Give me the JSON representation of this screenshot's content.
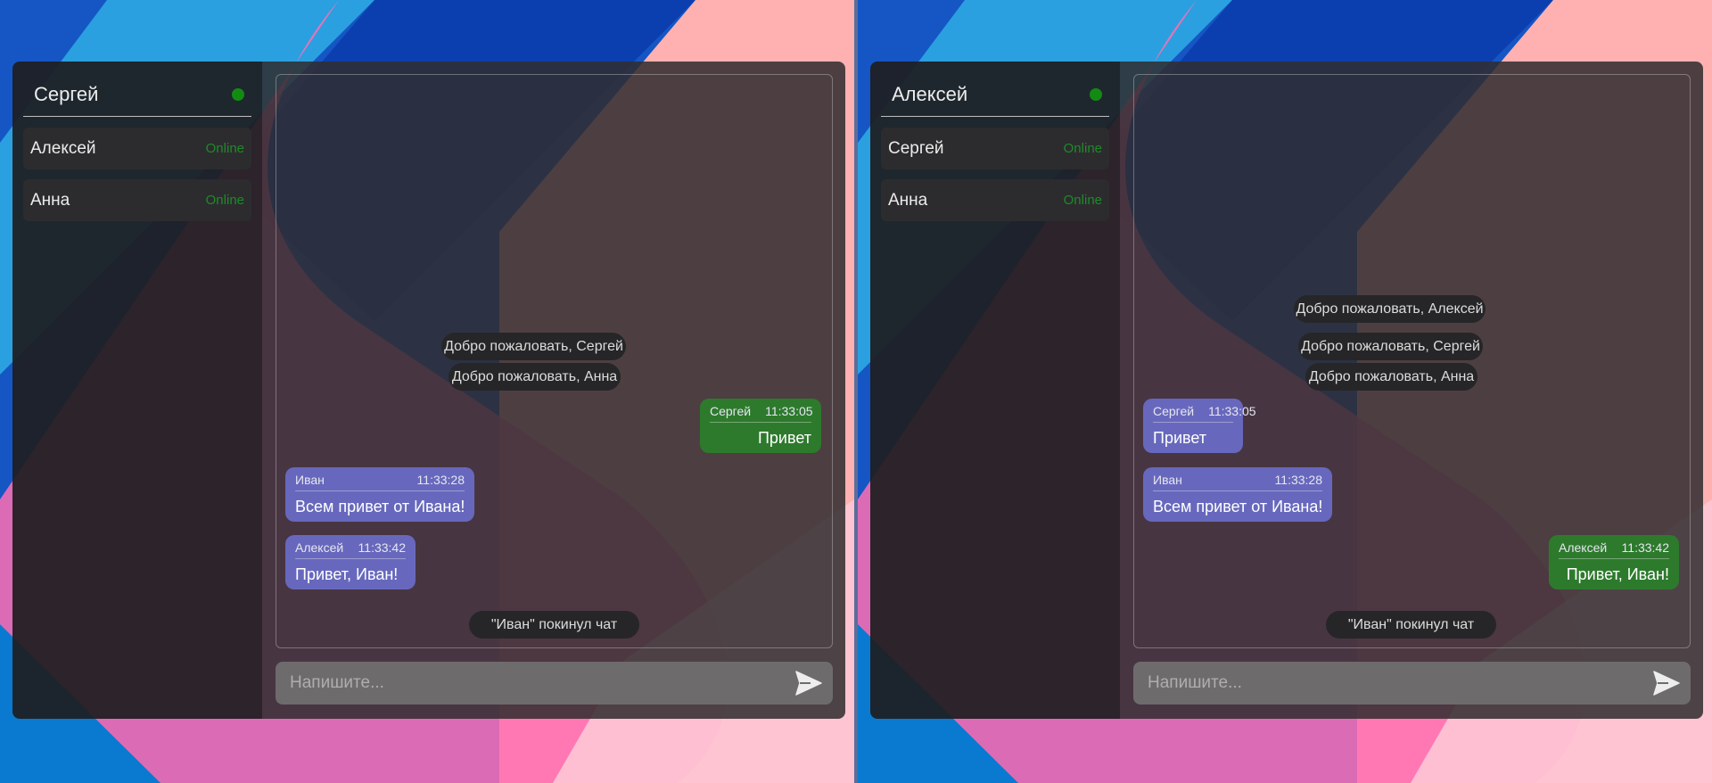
{
  "windows": [
    {
      "current_user": "Сергей",
      "users": [
        {
          "name": "Алексей",
          "status": "Online"
        },
        {
          "name": "Анна",
          "status": "Online"
        }
      ],
      "system_messages": [
        "Добро пожаловать, Сергей",
        "Добро пожаловать, Анна",
        "\"Иван\" покинул чат"
      ],
      "messages": [
        {
          "author": "Сергей",
          "time": "11:33:05",
          "text": "Привет",
          "own": true
        },
        {
          "author": "Иван",
          "time": "11:33:28",
          "text": "Всем привет от Ивана!",
          "own": false
        },
        {
          "author": "Алексей",
          "time": "11:33:42",
          "text": "Привет, Иван!",
          "own": false
        }
      ],
      "input_placeholder": "Напишите..."
    },
    {
      "current_user": "Алексей",
      "users": [
        {
          "name": "Сергей",
          "status": "Online"
        },
        {
          "name": "Анна",
          "status": "Online"
        }
      ],
      "system_messages": [
        "Добро пожаловать, Алексей",
        "Добро пожаловать, Сергей",
        "Добро пожаловать, Анна",
        "\"Иван\" покинул чат"
      ],
      "messages": [
        {
          "author": "Сергей",
          "time": "11:33:05",
          "text": "Привет",
          "own": false
        },
        {
          "author": "Иван",
          "time": "11:33:28",
          "text": "Всем привет от Ивана!",
          "own": false
        },
        {
          "author": "Алексей",
          "time": "11:33:42",
          "text": "Привет, Иван!",
          "own": true
        }
      ],
      "input_placeholder": "Напишите..."
    }
  ],
  "colors": {
    "online": "#138b13",
    "own_message": "#2d7a2d",
    "other_message": "#6768bd"
  },
  "icons": {
    "status": "online-dot-icon",
    "send": "send-icon"
  }
}
